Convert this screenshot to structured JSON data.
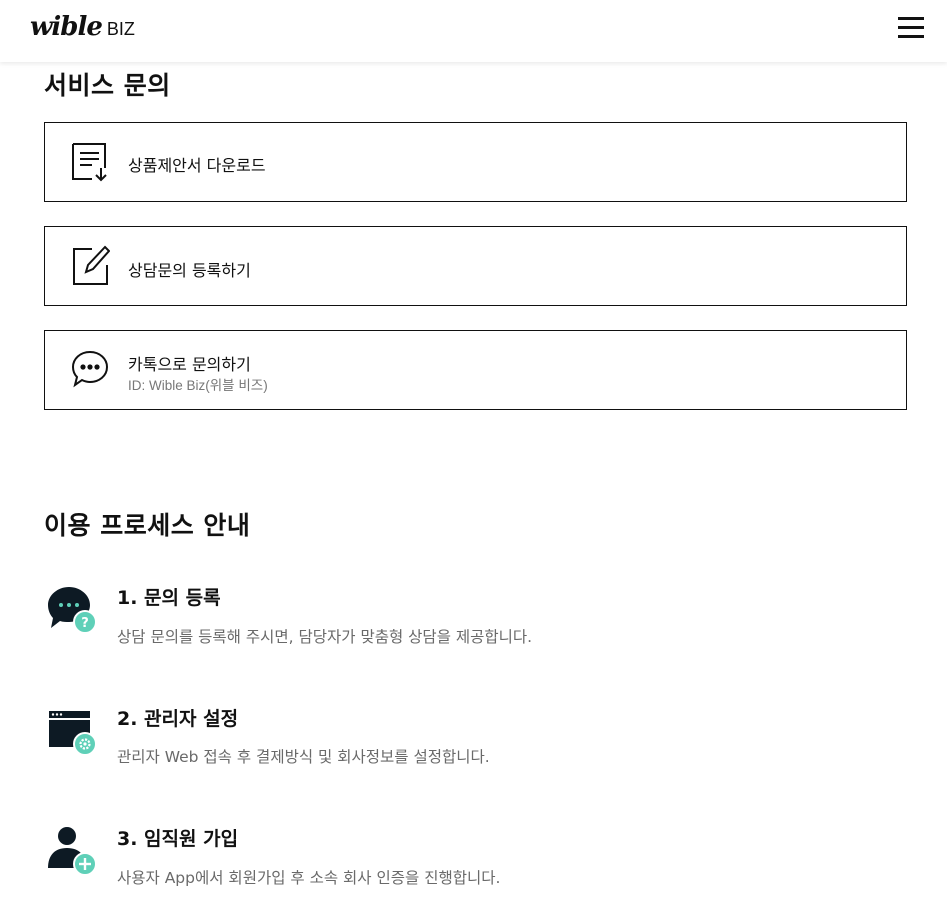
{
  "header": {
    "logo_main": "wible",
    "logo_sub": "BIZ",
    "menu_icon": "hamburger-menu-icon"
  },
  "service_inquiry": {
    "title": "서비스 문의",
    "cards": [
      {
        "icon": "document-download-icon",
        "label": "상품제안서 다운로드"
      },
      {
        "icon": "edit-pencil-icon",
        "label": "상담문의 등록하기"
      },
      {
        "icon": "chat-bubble-icon",
        "label": "카톡으로 문의하기",
        "sub": "ID: Wible Biz(위블 비즈)"
      }
    ]
  },
  "process": {
    "title": "이용 프로세스 안내",
    "steps": [
      {
        "icon": "chat-question-icon",
        "title": "1. 문의 등록",
        "desc": "상담 문의를 등록해 주시면, 담당자가 맞춤형 상담을 제공합니다."
      },
      {
        "icon": "browser-settings-icon",
        "title": "2. 관리자 설정",
        "desc": "관리자 Web 접속 후 결제방식 및 회사정보를 설정합니다."
      },
      {
        "icon": "user-add-icon",
        "title": "3. 임직원 가입",
        "desc": "사용자 App에서 회원가입 후 소속 회사 인증을 진행합니다."
      }
    ]
  },
  "colors": {
    "accent": "#5fd0b8",
    "text": "#111111",
    "muted": "#6a6a6a",
    "icon_dark": "#0d1a24"
  }
}
